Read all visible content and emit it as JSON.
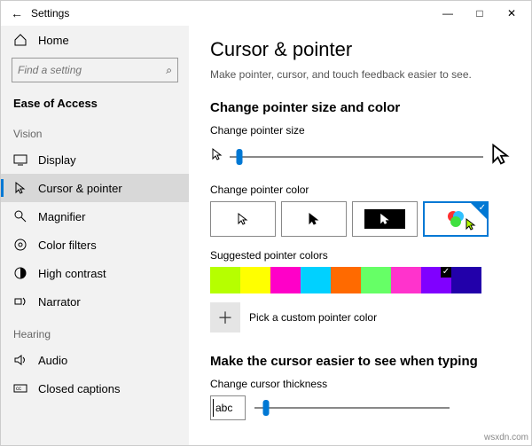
{
  "titlebar": {
    "app": "Settings"
  },
  "sidebar": {
    "home": "Home",
    "search_placeholder": "Find a setting",
    "category": "Ease of Access",
    "section_vision": "Vision",
    "section_hearing": "Hearing",
    "items_vision": [
      "Display",
      "Cursor & pointer",
      "Magnifier",
      "Color filters",
      "High contrast",
      "Narrator"
    ],
    "items_hearing": [
      "Audio",
      "Closed captions"
    ]
  },
  "page": {
    "title": "Cursor & pointer",
    "subtitle": "Make pointer, cursor, and touch feedback easier to see.",
    "section_size_color": "Change pointer size and color",
    "label_pointer_size": "Change pointer size",
    "pointer_size_pct": 4,
    "label_pointer_color": "Change pointer color",
    "label_suggested": "Suggested pointer colors",
    "pick_custom": "Pick a custom pointer color",
    "swatches": [
      "#b6ff00",
      "#ffff00",
      "#ff00c8",
      "#00d1ff",
      "#ff6a00",
      "#66ff66",
      "#ff33cc",
      "#8000ff",
      "#2200aa"
    ],
    "swatch_selected_index": 7,
    "section_typing": "Make the cursor easier to see when typing",
    "label_thickness": "Change cursor thickness",
    "thickness_pct": 6,
    "abc": "abc"
  },
  "watermark": "wsxdn.com"
}
